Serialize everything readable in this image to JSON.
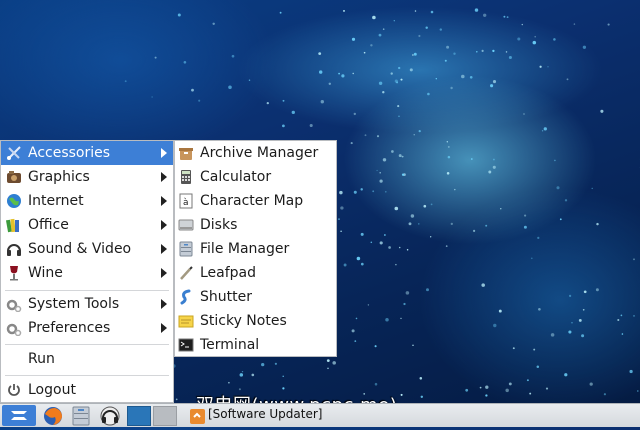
{
  "main_menu": {
    "items": [
      {
        "label": "Accessories",
        "icon": "accessories-icon",
        "has_submenu": true,
        "active": true
      },
      {
        "label": "Graphics",
        "icon": "graphics-icon",
        "has_submenu": true
      },
      {
        "label": "Internet",
        "icon": "internet-icon",
        "has_submenu": true
      },
      {
        "label": "Office",
        "icon": "office-icon",
        "has_submenu": true
      },
      {
        "label": "Sound & Video",
        "icon": "headphones-icon",
        "has_submenu": true
      },
      {
        "label": "Wine",
        "icon": "wine-icon",
        "has_submenu": true
      },
      {
        "label": "System Tools",
        "icon": "gears-icon",
        "has_submenu": true
      },
      {
        "label": "Preferences",
        "icon": "gears-icon",
        "has_submenu": true
      },
      {
        "label": "Run"
      },
      {
        "label": "Logout",
        "icon": "power-icon"
      }
    ]
  },
  "submenu": {
    "items": [
      {
        "label": "Archive Manager",
        "icon": "archive-icon"
      },
      {
        "label": "Calculator",
        "icon": "calculator-icon"
      },
      {
        "label": "Character Map",
        "icon": "character-map-icon"
      },
      {
        "label": "Disks",
        "icon": "disks-icon"
      },
      {
        "label": "File Manager",
        "icon": "file-manager-icon"
      },
      {
        "label": "Leafpad",
        "icon": "leafpad-icon"
      },
      {
        "label": "Shutter",
        "icon": "shutter-icon"
      },
      {
        "label": "Sticky Notes",
        "icon": "sticky-notes-icon"
      },
      {
        "label": "Terminal",
        "icon": "terminal-icon"
      }
    ]
  },
  "taskbar": {
    "task_label": "[Software Updater]"
  },
  "watermark": "双电网(www.pcpc.me)",
  "colors": {
    "menu_highlight": "#3d7fd6",
    "menu_background": "#ffffff",
    "taskbar_background": "#dfe2e5"
  }
}
